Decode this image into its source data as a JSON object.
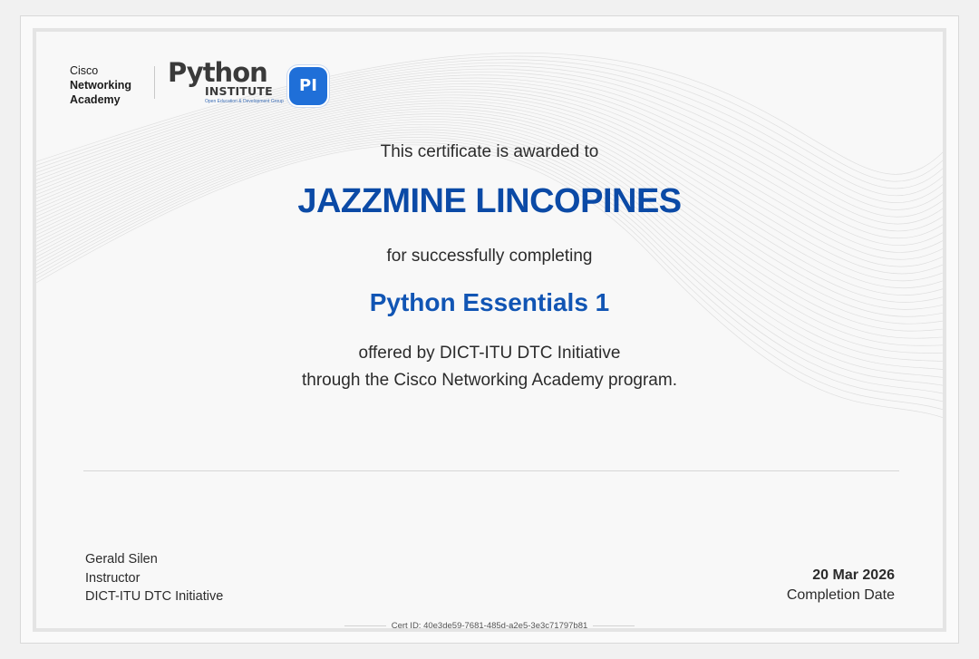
{
  "logos": {
    "cisco": {
      "line1": "Cisco",
      "line2": "Networking",
      "line3": "Academy"
    },
    "python_institute": {
      "word": "Python",
      "sub": "INSTITUTE",
      "tagline": "Open Education & Development Group",
      "badge": "PI"
    }
  },
  "certificate": {
    "awarded_to": "This certificate is awarded to",
    "recipient": "JAZZMINE LINCOPINES",
    "completing": "for successfully completing",
    "course": "Python Essentials 1",
    "offered_by": "offered by DICT-ITU DTC Initiative",
    "program": "through the Cisco Networking Academy program."
  },
  "instructor": {
    "name": "Gerald Silen",
    "role": "Instructor",
    "organization": "DICT-ITU DTC Initiative"
  },
  "completion": {
    "date": "20 Mar 2026",
    "label": "Completion Date"
  },
  "cert_id": "Cert ID: 40e3de59-7681-485d-a2e5-3e3c71797b81",
  "colors": {
    "recipient": "#0b4aa6",
    "course": "#1155b4",
    "pi_badge": "#1f6fd8"
  }
}
